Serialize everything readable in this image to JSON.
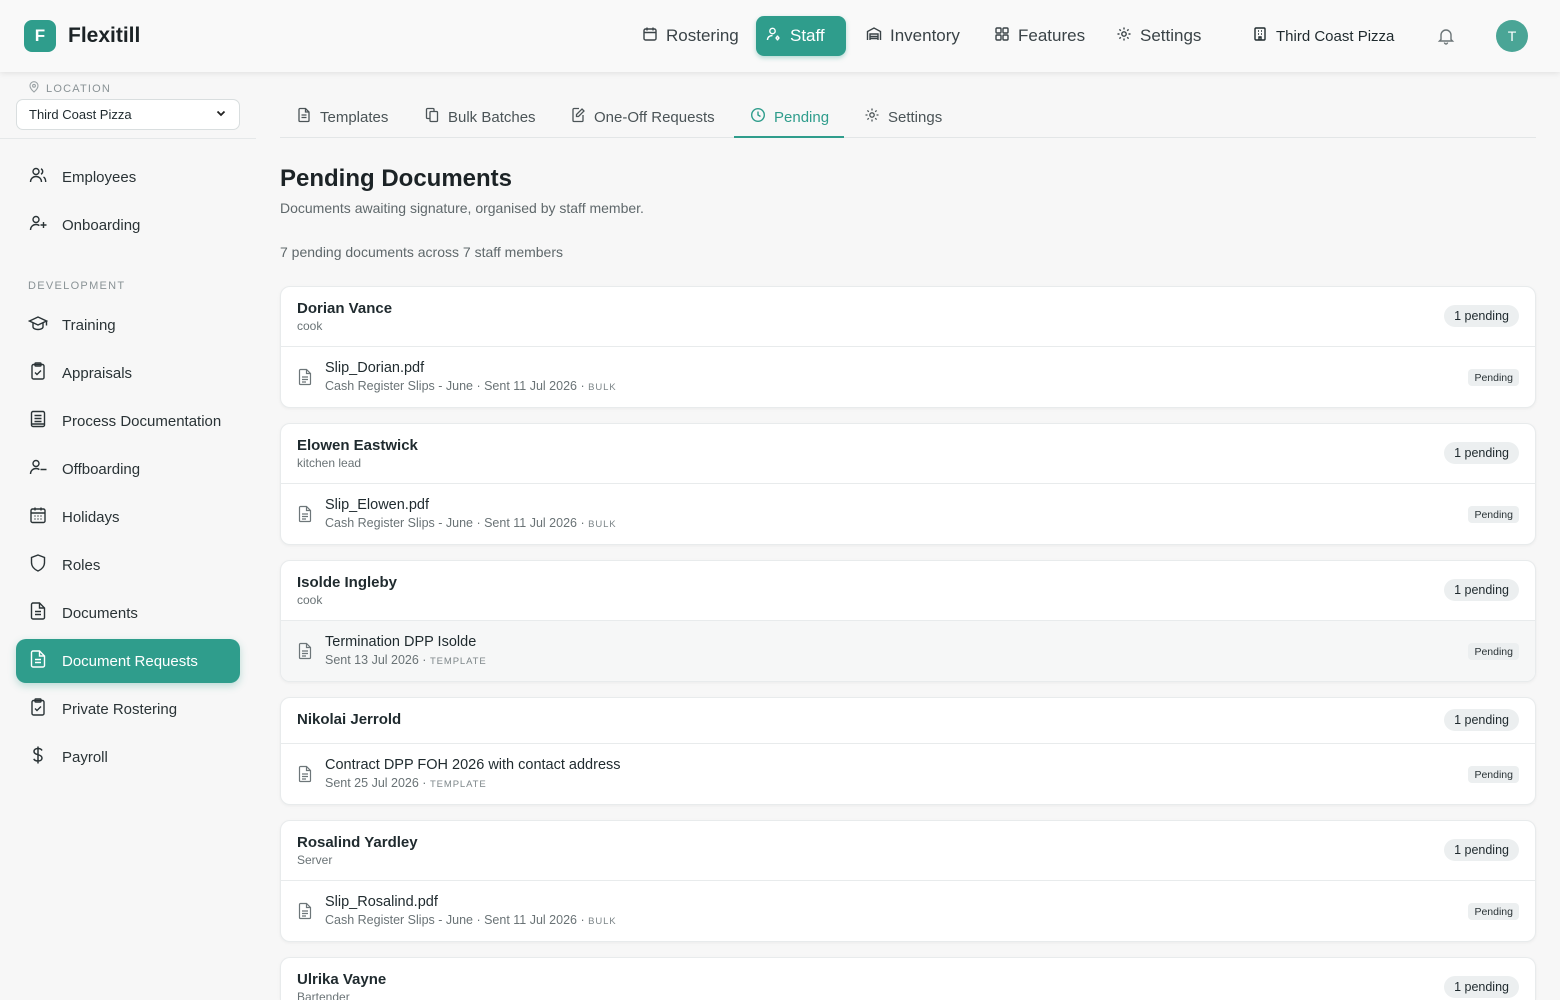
{
  "app": {
    "logo_letter": "F",
    "name": "Flexitill"
  },
  "topnav": {
    "items": [
      {
        "label": "Rostering",
        "icon": "calendar-icon"
      },
      {
        "label": "Staff",
        "icon": "user-cog-icon",
        "active": true
      },
      {
        "label": "Inventory",
        "icon": "warehouse-icon"
      },
      {
        "label": "Features",
        "icon": "grid-icon"
      },
      {
        "label": "Settings",
        "icon": "gear-icon"
      }
    ],
    "location": "Third Coast Pizza",
    "avatar_initial": "T"
  },
  "sidebar": {
    "location_label": "LOCATION",
    "location_value": "Third Coast Pizza",
    "items": [
      {
        "label": "Employees",
        "icon": "users-icon"
      },
      {
        "label": "Onboarding",
        "icon": "user-plus-icon"
      }
    ],
    "section_label": "DEVELOPMENT",
    "dev_items": [
      {
        "label": "Training",
        "icon": "graduation-cap-icon"
      },
      {
        "label": "Appraisals",
        "icon": "clipboard-check-icon"
      },
      {
        "label": "Process Documentation",
        "icon": "book-icon"
      },
      {
        "label": "Offboarding",
        "icon": "user-minus-icon"
      },
      {
        "label": "Holidays",
        "icon": "calendar-days-icon"
      },
      {
        "label": "Roles",
        "icon": "shield-icon"
      },
      {
        "label": "Documents",
        "icon": "file-text-icon"
      },
      {
        "label": "Document Requests",
        "icon": "file-text-icon",
        "active": true
      },
      {
        "label": "Private Rostering",
        "icon": "clipboard-check-icon"
      },
      {
        "label": "Payroll",
        "icon": "dollar-icon"
      }
    ]
  },
  "tabs": [
    {
      "label": "Templates",
      "icon": "file-icon"
    },
    {
      "label": "Bulk Batches",
      "icon": "files-icon"
    },
    {
      "label": "One-Off Requests",
      "icon": "file-edit-icon"
    },
    {
      "label": "Pending",
      "icon": "clock-icon",
      "active": true
    },
    {
      "label": "Settings",
      "icon": "gear-icon"
    }
  ],
  "page": {
    "title": "Pending Documents",
    "subtitle": "Documents awaiting signature, organised by staff member.",
    "summary": "7 pending documents across 7 staff members"
  },
  "staff": [
    {
      "name": "Dorian Vance",
      "role": "cook",
      "count": "1 pending",
      "doc": {
        "title": "Slip_Dorian.pdf",
        "meta": "Cash Register Slips - June · Sent 11 Jul 2026 · ",
        "tag": "BULK",
        "status": "Pending"
      }
    },
    {
      "name": "Elowen Eastwick",
      "role": "kitchen lead",
      "count": "1 pending",
      "doc": {
        "title": "Slip_Elowen.pdf",
        "meta": "Cash Register Slips - June · Sent 11 Jul 2026 · ",
        "tag": "BULK",
        "status": "Pending"
      }
    },
    {
      "name": "Isolde Ingleby",
      "role": "cook",
      "count": "1 pending",
      "doc": {
        "title": "Termination DPP Isolde",
        "meta": "Sent 13 Jul 2026 · ",
        "tag": "TEMPLATE",
        "status": "Pending"
      }
    },
    {
      "name": "Nikolai Jerrold",
      "role": "",
      "count": "1 pending",
      "doc": {
        "title": "Contract DPP FOH 2026 with contact address",
        "meta": "Sent 25 Jul 2026 · ",
        "tag": "TEMPLATE",
        "status": "Pending"
      }
    },
    {
      "name": "Rosalind Yardley",
      "role": "Server",
      "count": "1 pending",
      "doc": {
        "title": "Slip_Rosalind.pdf",
        "meta": "Cash Register Slips - June · Sent 11 Jul 2026 · ",
        "tag": "BULK",
        "status": "Pending"
      }
    },
    {
      "name": "Ulrika Vayne",
      "role": "Bartender",
      "count": "1 pending"
    }
  ]
}
